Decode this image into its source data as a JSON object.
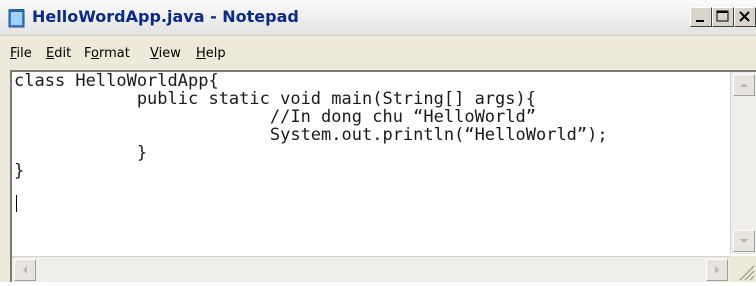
{
  "window": {
    "title": "HelloWordApp.java - Notepad"
  },
  "menu": {
    "items": [
      {
        "accel": "F",
        "rest": "ile"
      },
      {
        "accel": "E",
        "rest": "dit"
      },
      {
        "pre": "F",
        "accel": "o",
        "rest": "rmat"
      },
      {
        "accel": "V",
        "rest": "iew"
      },
      {
        "accel": "H",
        "rest": "elp"
      }
    ]
  },
  "editor": {
    "code": "class HelloWorldApp{\n            public static void main(String[] args){\n                         //In dong chu “HelloWorld”\n                         System.out.println(“HelloWorld”);\n            }\n}"
  },
  "icons": {
    "app": "notepad-icon",
    "minimize": "minimize-icon",
    "maximize": "maximize-icon",
    "close": "close-icon",
    "scroll_up": "scroll-up-arrow-icon",
    "scroll_down": "scroll-down-arrow-icon",
    "scroll_left": "scroll-left-arrow-icon",
    "scroll_right": "scroll-right-arrow-icon",
    "resize": "resize-grip-icon"
  },
  "colors": {
    "title_text": "#0a2a8a",
    "window_face": "#ece9d8",
    "editor_bg": "#ffffff"
  }
}
